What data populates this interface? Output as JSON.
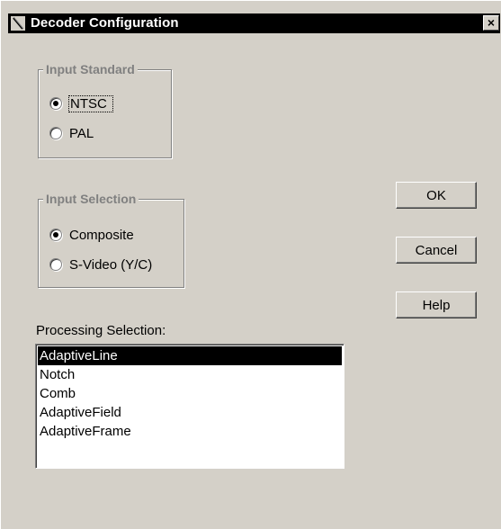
{
  "window": {
    "title": "Decoder Configuration",
    "close_label": "×"
  },
  "input_standard": {
    "legend": "Input Standard",
    "options": [
      {
        "label": "NTSC",
        "selected": true
      },
      {
        "label": "PAL",
        "selected": false
      }
    ]
  },
  "input_selection": {
    "legend": "Input Selection",
    "options": [
      {
        "label": "Composite",
        "selected": true
      },
      {
        "label": "S-Video (Y/C)",
        "selected": false
      }
    ]
  },
  "buttons": {
    "ok": "OK",
    "cancel": "Cancel",
    "help": "Help"
  },
  "processing": {
    "label": "Processing Selection:",
    "items": [
      "AdaptiveLine",
      "Notch",
      "Comb",
      "AdaptiveField",
      "AdaptiveFrame"
    ],
    "selected_index": 0
  },
  "icons": {
    "title_icon": "app-icon",
    "close_icon": "close-icon"
  },
  "colors": {
    "window_bg": "#d4d0c8",
    "titlebar_bg": "#000000",
    "selection_bg": "#000000",
    "group_text": "#808080"
  }
}
